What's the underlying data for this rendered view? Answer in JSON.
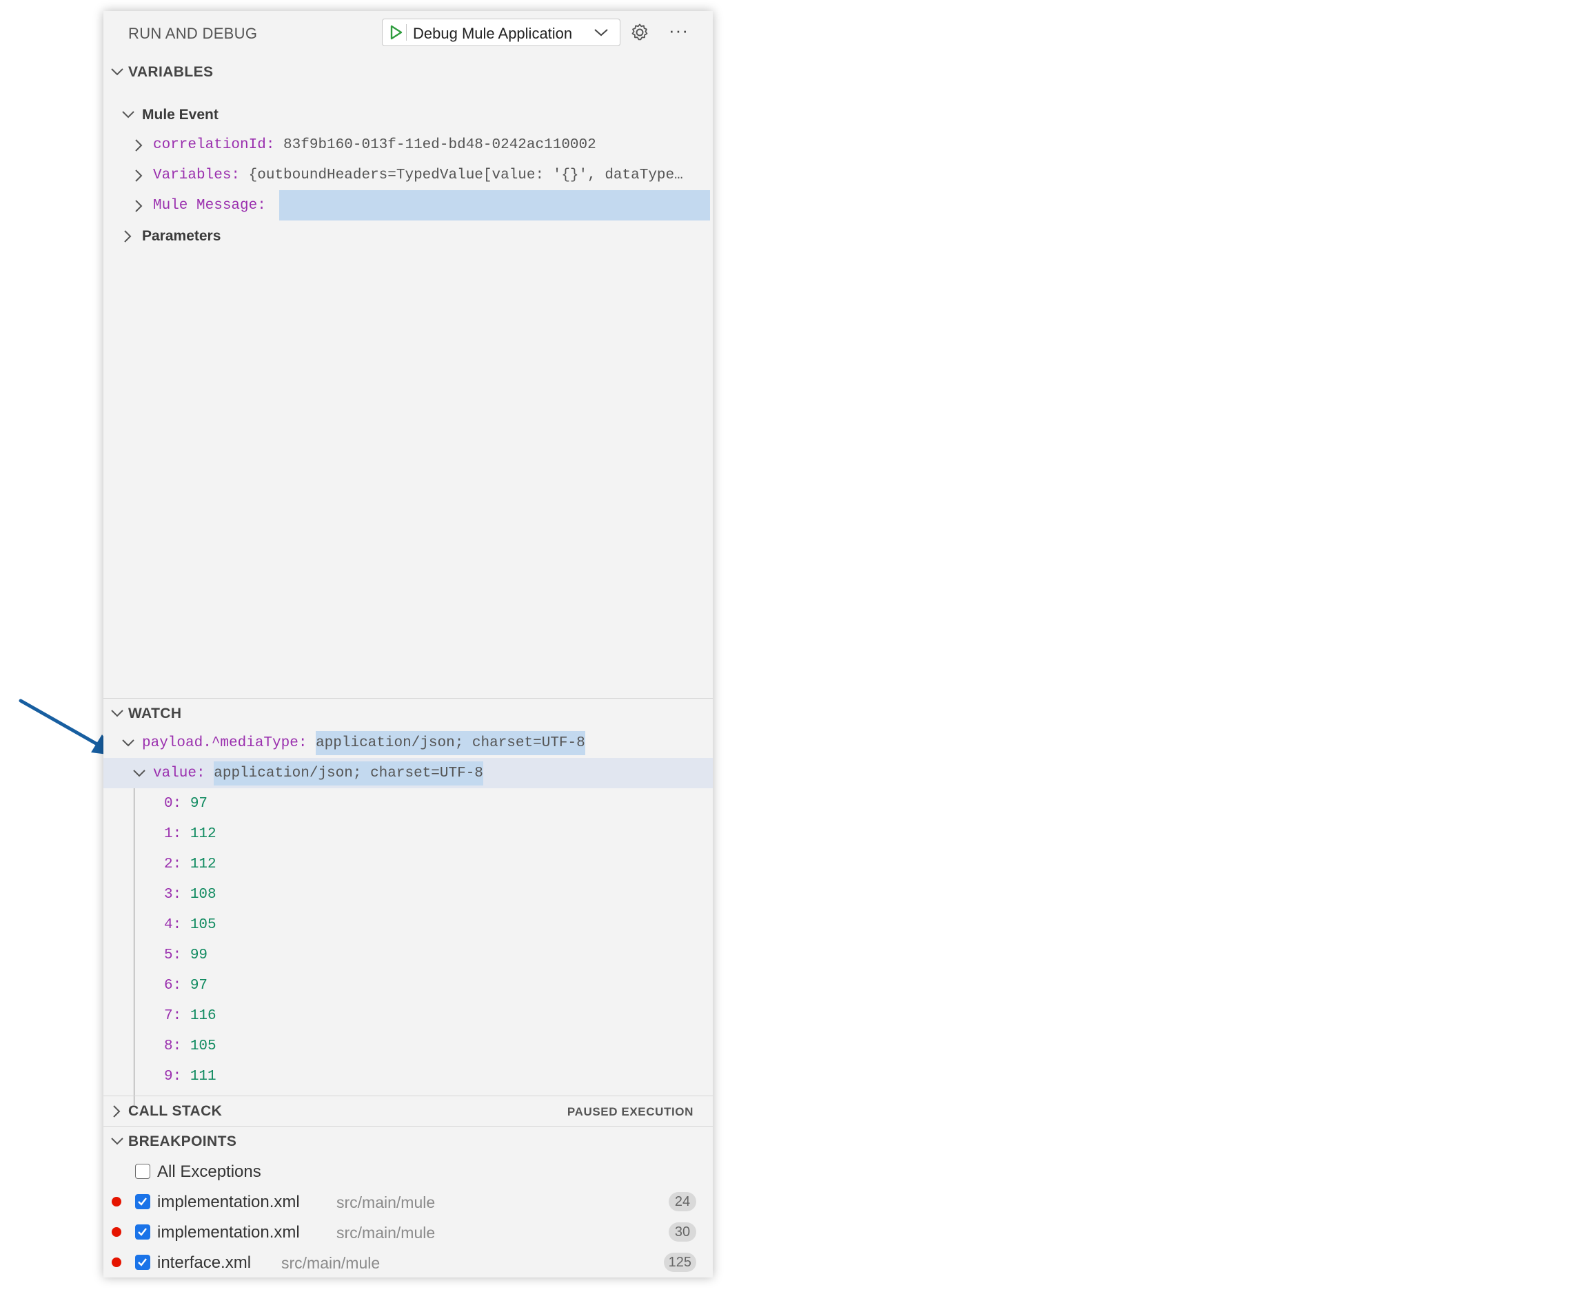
{
  "header": {
    "title": "RUN AND DEBUG",
    "launch_config": "Debug Mule Application",
    "icons": [
      "play-icon",
      "chevron-down-icon",
      "gear-icon",
      "more-icon"
    ]
  },
  "variables": {
    "section_label": "VARIABLES",
    "mule_event_label": "Mule Event",
    "correlation_key": "correlationId:",
    "correlation_value": "83f9b160-013f-11ed-bd48-0242ac110002",
    "variables_key": "Variables:",
    "variables_value": "{outboundHeaders=TypedValue[value: '{}', dataType…",
    "message_key": "Mule Message:",
    "parameters_label": "Parameters"
  },
  "watch": {
    "section_label": "WATCH",
    "expression_key": "payload.^mediaType:",
    "expression_value": "application/json; charset=UTF-8",
    "value_key": "value:",
    "value_value": "application/json; charset=UTF-8",
    "items": [
      {
        "key": "0:",
        "value": "97"
      },
      {
        "key": "1:",
        "value": "112"
      },
      {
        "key": "2:",
        "value": "112"
      },
      {
        "key": "3:",
        "value": "108"
      },
      {
        "key": "4:",
        "value": "105"
      },
      {
        "key": "5:",
        "value": "99"
      },
      {
        "key": "6:",
        "value": "97"
      },
      {
        "key": "7:",
        "value": "116"
      },
      {
        "key": "8:",
        "value": "105"
      },
      {
        "key": "9:",
        "value": "111"
      }
    ]
  },
  "call_stack": {
    "section_label": "CALL STACK",
    "status": "PAUSED EXECUTION"
  },
  "breakpoints": {
    "section_label": "BREAKPOINTS",
    "all_exceptions_label": "All Exceptions",
    "items": [
      {
        "file": "implementation.xml",
        "path": "src/main/mule",
        "line": "24"
      },
      {
        "file": "implementation.xml",
        "path": "src/main/mule",
        "line": "30"
      },
      {
        "file": "interface.xml",
        "path": "src/main/mule",
        "line": "125"
      }
    ]
  },
  "colors": {
    "key": "#9a2fae",
    "number": "#0f8a5f",
    "highlight": "#c3d9ef",
    "breakpoint": "#e51400",
    "checkbox": "#1a73e8",
    "arrow": "#175ea0"
  }
}
